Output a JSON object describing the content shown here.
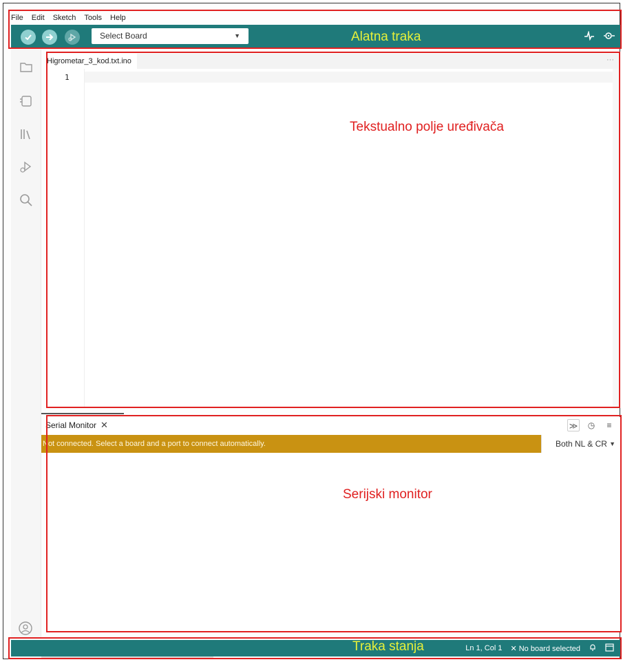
{
  "menu": [
    "File",
    "Edit",
    "Sketch",
    "Tools",
    "Help"
  ],
  "toolbar": {
    "board_placeholder": "Select Board",
    "annotation": "Alatna traka",
    "plotter_icon": "serial-plotter-icon",
    "monitor_icon": "serial-monitor-icon"
  },
  "sidebar": {
    "items": [
      "folder-icon",
      "board-manager-icon",
      "library-icon",
      "debug-icon",
      "search-icon"
    ],
    "profile": "profile-icon"
  },
  "editor": {
    "tab_label": "Higrometar_3_kod.txt.ino",
    "more": "···",
    "line_number": "1",
    "annotation": "Tekstualno polje uređivača"
  },
  "serial_monitor": {
    "title": "Serial Monitor",
    "close": "✕",
    "banner": "Not connected. Select a board and a port to connect automatically.",
    "line_ending": "Both NL & CR",
    "annotation": "Serijski monitor"
  },
  "statusbar": {
    "position": "Ln 1, Col 1",
    "board_status": "✕ No board selected",
    "annotation": "Traka stanja"
  },
  "colors": {
    "accent": "#1f7a7a",
    "warning": "#c99212",
    "annotation_red": "#e02020",
    "annotation_yellow": "#e6f03a"
  }
}
